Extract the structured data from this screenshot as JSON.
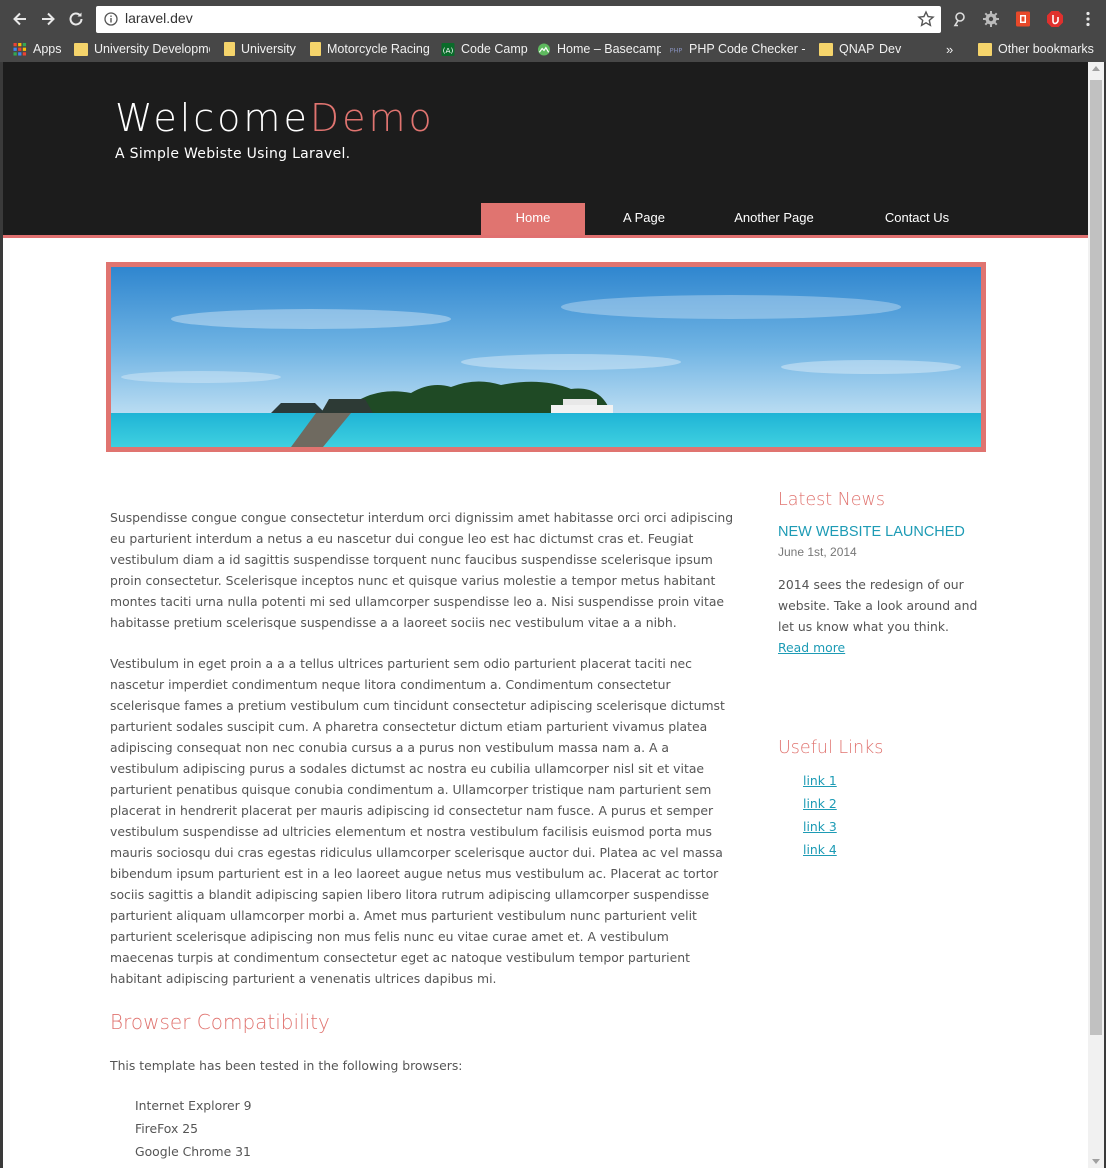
{
  "browser": {
    "url": "laravel.dev",
    "bookmarks": [
      {
        "label": "Apps",
        "icon": "apps-grid-icon"
      },
      {
        "label": "University Developme",
        "icon": "folder-icon"
      },
      {
        "label": "University",
        "icon": "bookmark-icon"
      },
      {
        "label": "Motorcycle Racing",
        "icon": "bookmark-icon"
      },
      {
        "label": "Code Camp",
        "icon": "codecamp-icon"
      },
      {
        "label": "Home – Basecamp",
        "icon": "basecamp-icon"
      },
      {
        "label": "PHP Code Checker - S",
        "icon": "php-icon"
      },
      {
        "label": "QNAP",
        "icon": "folder-icon"
      },
      {
        "label": "Dev",
        "icon": "folder-icon"
      }
    ],
    "overflow_label": "»",
    "other_bookmarks": "Other bookmarks"
  },
  "header": {
    "logo_welcome": "Welcome",
    "logo_demo": "Demo",
    "slogan": "A Simple Webiste Using Laravel.",
    "menu": [
      {
        "label": "Home",
        "active": true
      },
      {
        "label": "A Page",
        "active": false
      },
      {
        "label": "Another Page",
        "active": false
      },
      {
        "label": "Contact Us",
        "active": false
      }
    ]
  },
  "content": {
    "paragraph1": "Suspendisse congue congue consectetur interdum orci dignissim amet habitasse orci orci adipiscing eu parturient interdum a netus a eu nascetur dui congue leo est hac dictumst cras et. Feugiat vestibulum diam a id sagittis suspendisse torquent nunc faucibus suspendisse scelerisque ipsum proin consectetur. Scelerisque inceptos nunc et quisque varius molestie a tempor metus habitant montes taciti urna nulla potenti mi sed ullamcorper suspendisse leo a. Nisi suspendisse proin vitae habitasse pretium scelerisque suspendisse a a laoreet sociis nec vestibulum vitae a a nibh.",
    "paragraph2": "Vestibulum in eget proin a a a tellus ultrices parturient sem odio parturient placerat taciti nec nascetur imperdiet condimentum neque litora condimentum a. Condimentum consectetur scelerisque fames a pretium vestibulum cum tincidunt consectetur adipiscing scelerisque dictumst parturient sodales suscipit cum. A pharetra consectetur dictum etiam parturient vivamus platea adipiscing consequat non nec conubia cursus a a purus non vestibulum massa nam a. A a vestibulum adipiscing purus a sodales dictumst ac nostra eu cubilia ullamcorper nisl sit et vitae parturient penatibus quisque conubia condimentum a. Ullamcorper tristique nam parturient sem placerat in hendrerit placerat per mauris adipiscing id consectetur nam fusce. A purus et semper vestibulum suspendisse ad ultricies elementum et nostra vestibulum facilisis euismod porta mus mauris sociosqu dui cras egestas ridiculus ullamcorper scelerisque auctor dui. Platea ac vel massa bibendum ipsum parturient est in a leo laoreet augue netus mus vestibulum ac. Placerat ac tortor sociis sagittis a blandit adipiscing sapien libero litora rutrum adipiscing ullamcorper suspendisse parturient aliquam ullamcorper morbi a. Amet mus parturient vestibulum nunc parturient velit parturient scelerisque adipiscing non mus felis nunc eu vitae curae amet et. A vestibulum maecenas turpis at condimentum consectetur eget ac natoque vestibulum tempor parturient habitant adipiscing parturient a venenatis ultrices dapibus mi.",
    "compat_heading": "Browser Compatibility",
    "compat_intro": "This template has been tested in the following browsers:",
    "browsers": [
      "Internet Explorer 9",
      "FireFox 25",
      "Google Chrome 31"
    ]
  },
  "sidebar": {
    "news_heading": "Latest News",
    "news_title": "NEW WEBSITE LAUNCHED",
    "news_date": "June 1st, 2014",
    "news_body": "2014 sees the redesign of our website. Take a look around and let us know what you think.",
    "read_more": "Read more",
    "links_heading": "Useful Links",
    "links": [
      "link 1",
      "link 2",
      "link 3",
      "link 4"
    ]
  },
  "colors": {
    "accent": "#e07470",
    "header_bg": "#1c1c1c",
    "link": "#1d9bb5",
    "chrome_bg": "#474747"
  }
}
